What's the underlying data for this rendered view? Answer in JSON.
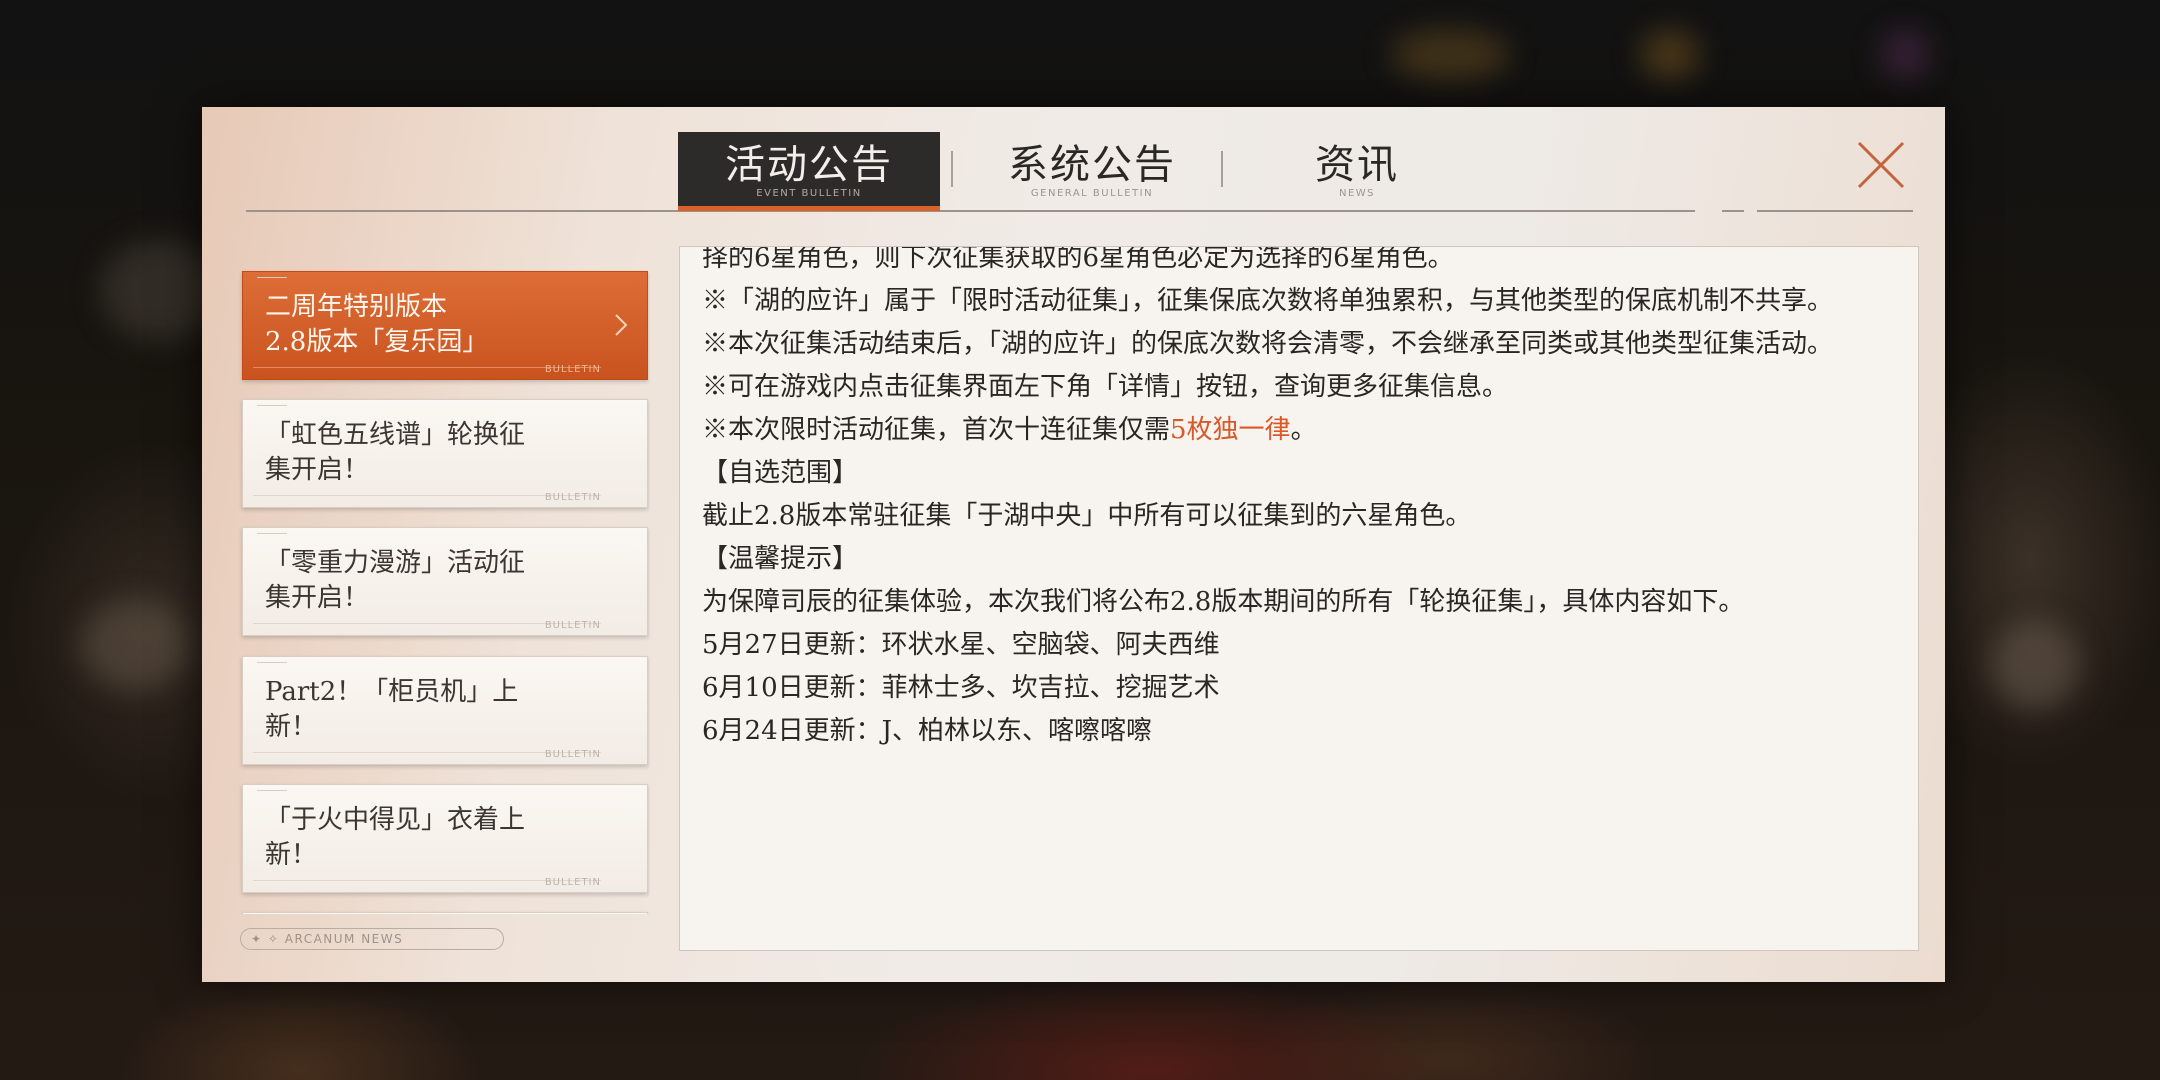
{
  "tabs": [
    {
      "label": "活动公告",
      "sub": "EVENT BULLETIN",
      "active": true
    },
    {
      "label": "系统公告",
      "sub": "GENERAL BULLETIN",
      "active": false
    },
    {
      "label": "资讯",
      "sub": "NEWS",
      "active": false
    }
  ],
  "news_items": [
    {
      "title": "二周年特别版本\n2.8版本「复乐园」",
      "tag": "BULLETIN",
      "active": true
    },
    {
      "title": "「虹色五线谱」轮换征\n集开启！",
      "tag": "BULLETIN",
      "active": false
    },
    {
      "title": "「零重力漫游」活动征\n集开启！",
      "tag": "BULLETIN",
      "active": false
    },
    {
      "title": "Part2！「柜员机」上\n新！",
      "tag": "BULLETIN",
      "active": false
    },
    {
      "title": "「于火中得见」衣着上\n新！",
      "tag": "BULLETIN",
      "active": false
    }
  ],
  "footer_label": "✦ ✧ ARCANUM NEWS",
  "content": {
    "top_cut": "择的6星角色，则下次征集获取的6星角色必定为选择的6星角色。",
    "p1": "※「湖的应许」属于「限时活动征集」，征集保底次数将单独累积，与其他类型的保底机制不共享。",
    "p2": "※本次征集活动结束后，「湖的应许」的保底次数将会清零，不会继承至同类或其他类型征集活动。",
    "p3": "※可在游戏内点击征集界面左下角「详情」按钮，查询更多征集信息。",
    "p4_pre": "※本次限时活动征集，首次十连征集仅需",
    "p4_hl": "5枚独一律",
    "p4_post": "。",
    "h1": "【自选范围】",
    "p5": "截止2.8版本常驻征集「于湖中央」中所有可以征集到的六星角色。",
    "h2": "【温馨提示】",
    "p6": "为保障司辰的征集体验，本次我们将公布2.8版本期间的所有「轮换征集」，具体内容如下。",
    "p7": "5月27日更新：环状水星、空脑袋、阿夫西维",
    "p8": "6月10日更新：菲林士多、坎吉拉、挖掘艺术",
    "p9": "6月24日更新：J、柏林以东、喀嚓喀嚓"
  },
  "colors": {
    "accent": "#d9622a",
    "highlight_text": "#d8592a",
    "tab_active_bg": "#2d2b29"
  }
}
